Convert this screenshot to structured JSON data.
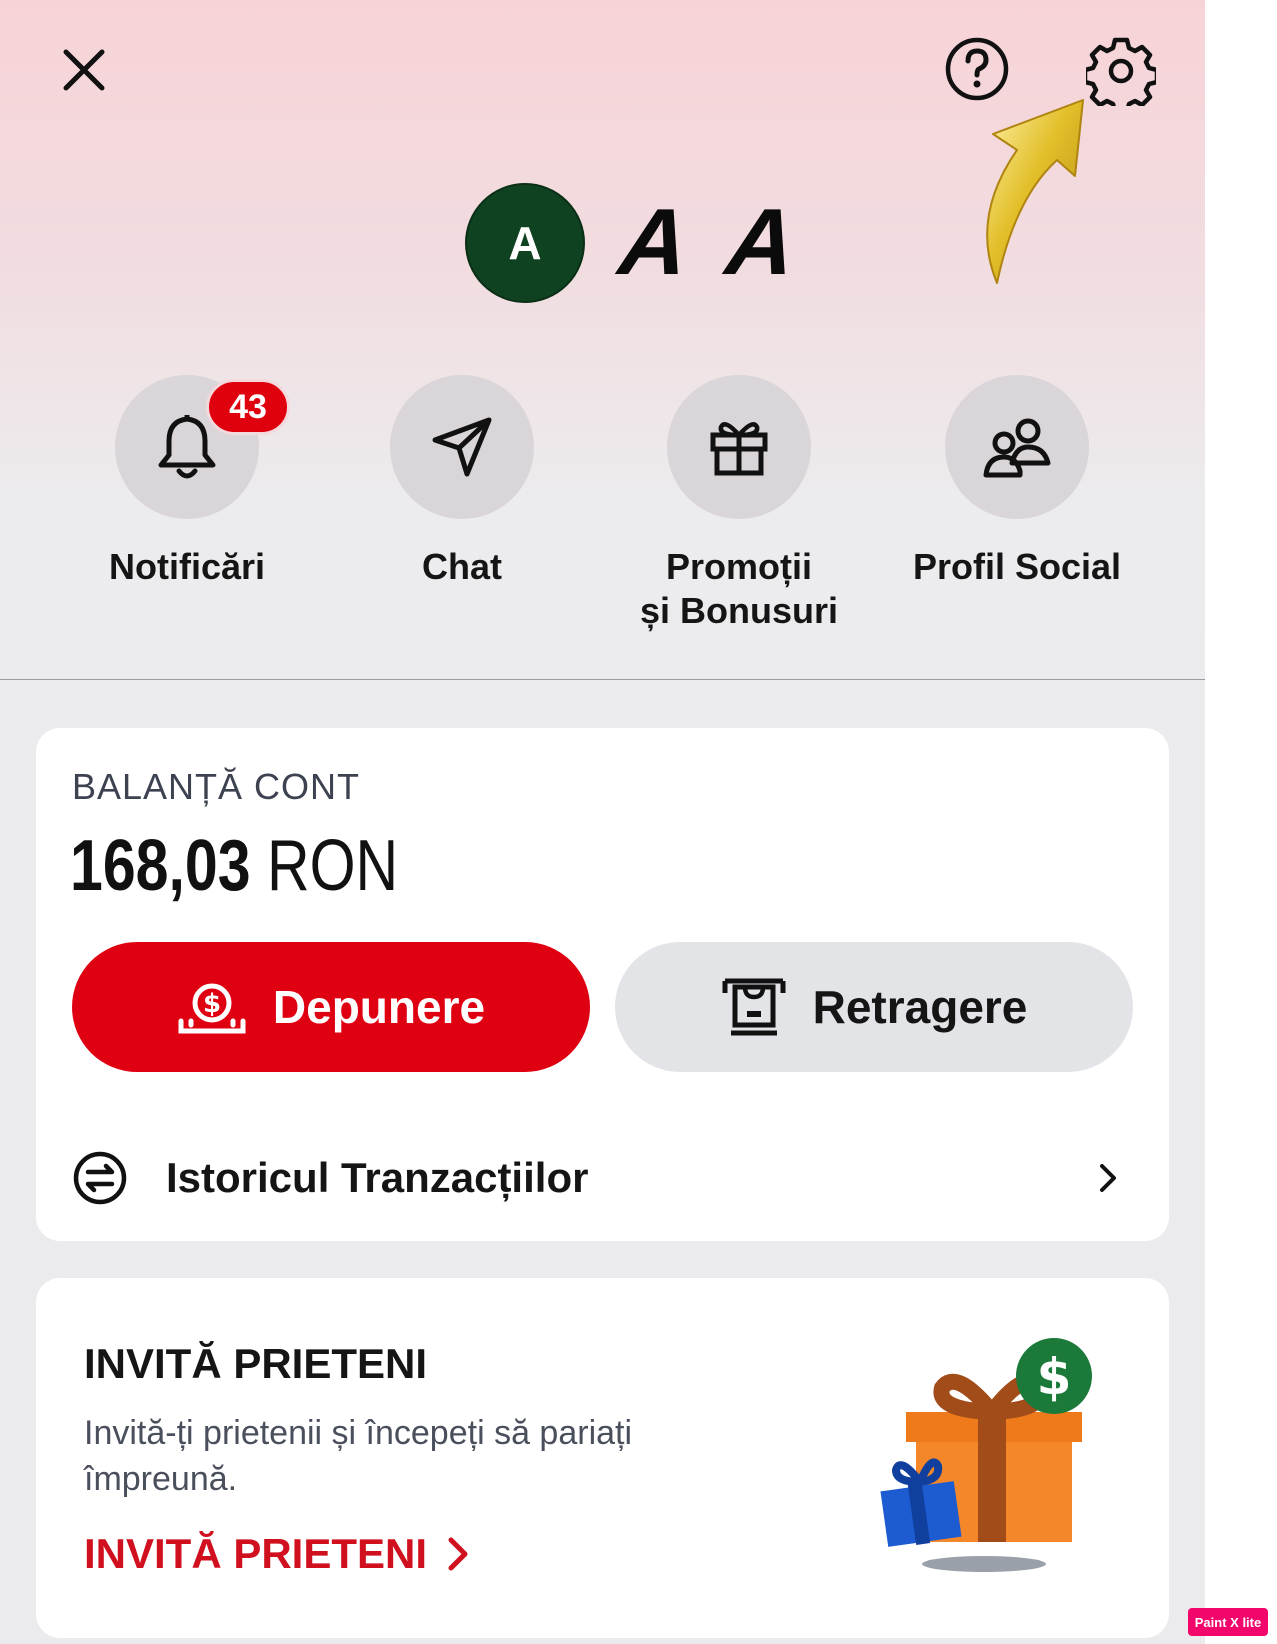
{
  "header": {
    "close_icon": "close-icon",
    "help_icon": "help-icon",
    "settings_icon": "gear-icon"
  },
  "profile": {
    "avatar_initial": "A",
    "name": "A A",
    "avatar_color": "#0e4220"
  },
  "actions": [
    {
      "label": "Notificări",
      "icon": "bell-icon",
      "badge": "43"
    },
    {
      "label": "Chat",
      "icon": "send-icon"
    },
    {
      "label_line1": "Promoții",
      "label_line2": "și Bonusuri",
      "icon": "gift-icon"
    },
    {
      "label": "Profil Social",
      "icon": "users-icon"
    }
  ],
  "balance": {
    "label": "BALANȚĂ CONT",
    "amount": "168,03",
    "currency": "RON",
    "deposit_label": "Depunere",
    "withdraw_label": "Retragere",
    "history_label": "Istoricul Tranzacțiilor"
  },
  "invite": {
    "title": "INVITĂ PRIETENI",
    "text": "Invită-ți prietenii și începeți să pariați împreună.",
    "link_label": "INVITĂ PRIETENI"
  },
  "colors": {
    "brand_red": "#df0011",
    "link_red": "#d0101e",
    "badge_red": "#e0010e",
    "arrow_gold": "#d6b320"
  },
  "watermark": "Paint X lite"
}
